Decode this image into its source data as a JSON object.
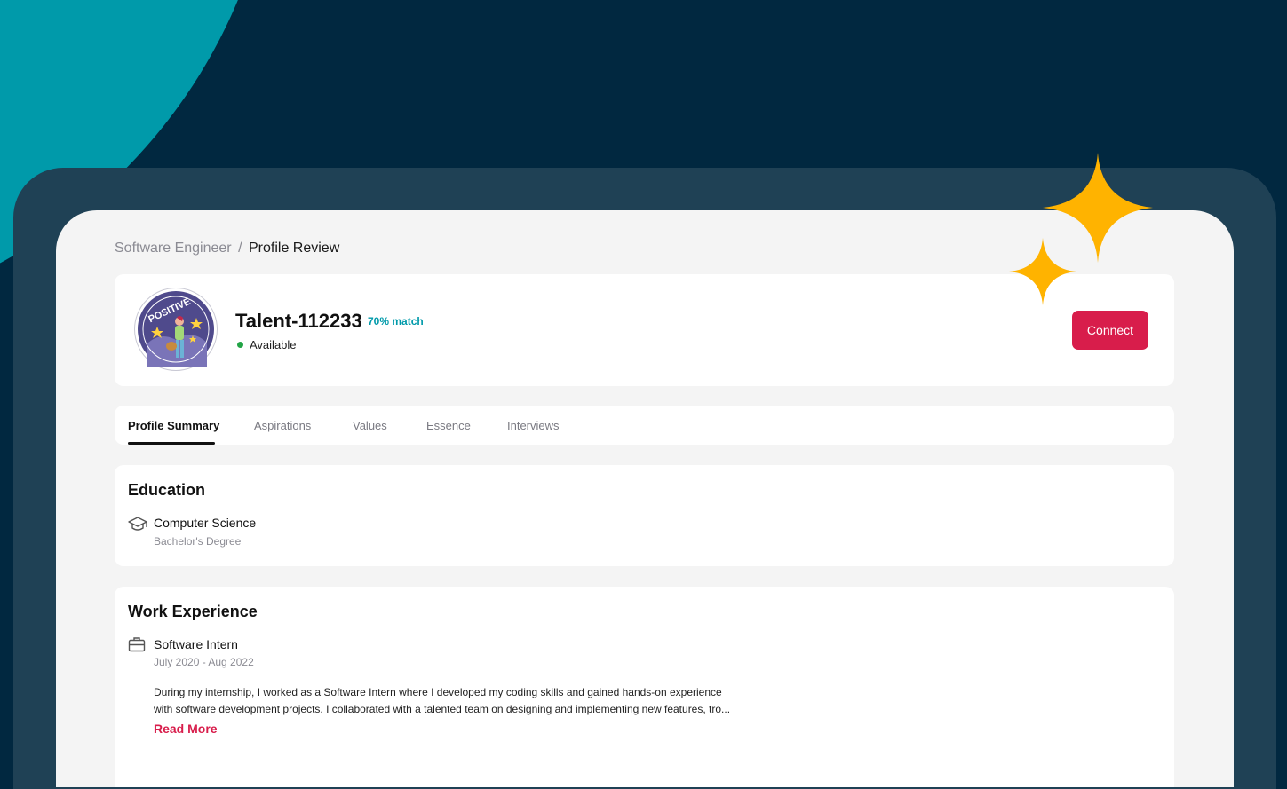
{
  "colors": {
    "background": "#012840",
    "accent_teal": "#009aaa",
    "frame": "#1f4155",
    "connect_red": "#d81d4b",
    "sparkle_yellow": "#ffb300",
    "status_green": "#22a446"
  },
  "breadcrumb": {
    "parent": "Software Engineer",
    "separator": "/",
    "current": "Profile Review"
  },
  "profile": {
    "avatar_icon": "positive-badge-avatar",
    "name": "Talent-112233",
    "match": "70% match",
    "status": "Available",
    "connect_label": "Connect"
  },
  "tabs": [
    {
      "label": "Profile Summary",
      "active": true
    },
    {
      "label": "Aspirations",
      "active": false
    },
    {
      "label": "Values",
      "active": false
    },
    {
      "label": "Essence",
      "active": false
    },
    {
      "label": "Interviews",
      "active": false
    }
  ],
  "education": {
    "title": "Education",
    "icon": "graduation-cap-icon",
    "field": "Computer Science",
    "degree": "Bachelor's Degree"
  },
  "work": {
    "title": "Work Experience",
    "icon": "briefcase-icon",
    "role": "Software Intern",
    "dates": "July 2020 - Aug 2022",
    "description_line1": "During my internship, I worked as a Software Intern where I developed my coding skills and gained hands-on experience",
    "description_line2": "with software development projects. I collaborated with a talented team on designing and implementing new features, tro...",
    "read_more": "Read More"
  }
}
